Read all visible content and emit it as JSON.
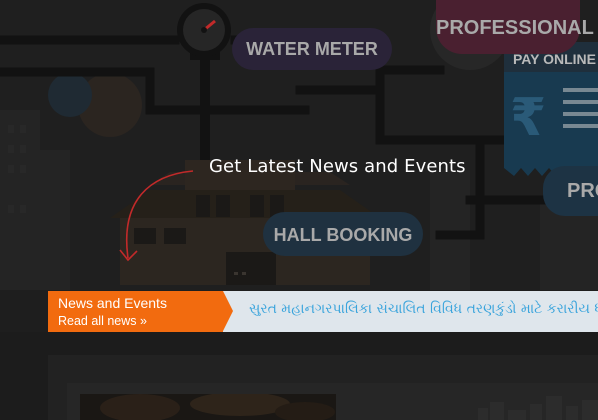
{
  "hero": {
    "title": "Get Latest News and Events",
    "tags": {
      "water_meter": "WATER METER",
      "professional": "PROFESSIONAL",
      "pay_online": "PAY ONLINE T",
      "hall_booking": "HALL BOOKING",
      "pro": "PRO"
    },
    "currency_icon": "rupee-icon",
    "colors": {
      "background": "#1e1e1e",
      "water_meter_pill": "#2a2338",
      "professional_pill": "#4a2030",
      "hall_booking_pill": "#1f3140",
      "arrow": "#c22a2a"
    }
  },
  "ticker": {
    "label": "News and Events",
    "read_all": "Read all news »",
    "headline": "સુરત મહાનગરપાલિકા સંચાલિત વિવિધ તરણકુંડો માટે કરારીય ધ",
    "colors": {
      "label_bg": "#f26b0f",
      "body_bg": "#dfe6ec",
      "headline": "#3aa4dc"
    }
  }
}
